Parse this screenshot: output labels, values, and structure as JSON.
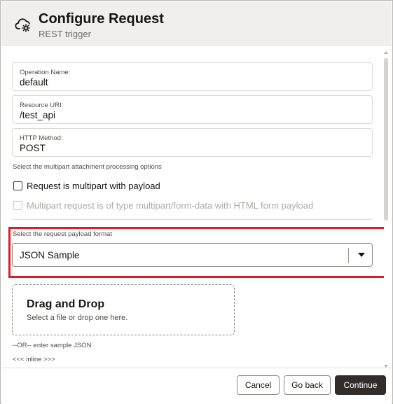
{
  "header": {
    "title": "Configure Request",
    "subtitle": "REST trigger",
    "icon": "cloud-gear-icon"
  },
  "form": {
    "operation_name": {
      "label": "Operation Name:",
      "value": "default"
    },
    "resource_uri": {
      "label": "Resource URI:",
      "value": "/test_api"
    },
    "http_method": {
      "label": "HTTP Method:",
      "value": "POST"
    },
    "multipart_helper": "Select the multipart attachment processing options",
    "checkbox_multipart": {
      "label": "Request is multipart with payload",
      "checked": false,
      "disabled": false
    },
    "checkbox_formdata": {
      "label": "Multipart request is of type multipart/form-data with HTML form payload",
      "checked": false,
      "disabled": true
    },
    "payload_format": {
      "label": "Select the request payload format",
      "value": "JSON Sample"
    },
    "dropzone": {
      "title": "Drag and Drop",
      "subtitle": "Select a file or drop one here."
    },
    "or_text": "--OR-- enter sample JSON",
    "inline_link": "<<< inline >>>"
  },
  "footer": {
    "cancel_label": "Cancel",
    "goback_label": "Go back",
    "continue_label": "Continue"
  },
  "colors": {
    "highlight": "#e01b24",
    "primary_button": "#312d2a",
    "header_bg": "#f1efed"
  }
}
